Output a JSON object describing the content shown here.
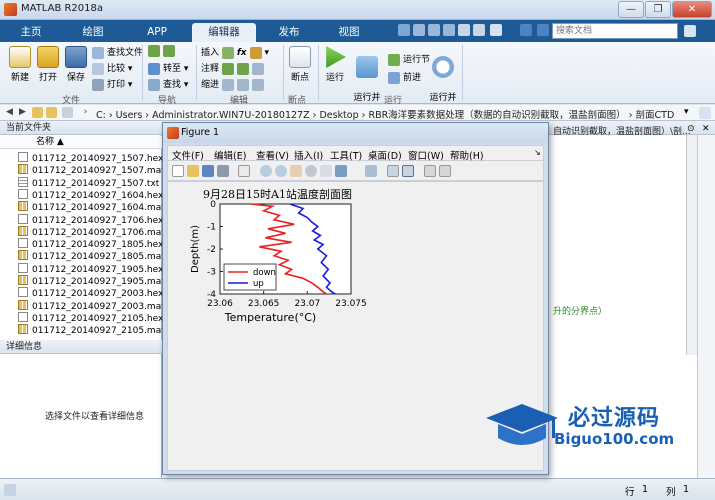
{
  "app": {
    "title": "MATLAB R2018a",
    "window_controls": [
      "—",
      "❐",
      "✕"
    ]
  },
  "ribbon_tabs": [
    {
      "label": "主页",
      "active": false
    },
    {
      "label": "绘图",
      "active": false
    },
    {
      "label": "APP",
      "active": false
    },
    {
      "label": "编辑器",
      "active": true
    },
    {
      "label": "发布",
      "active": false
    },
    {
      "label": "视图",
      "active": false
    }
  ],
  "search": {
    "placeholder": "搜索文档"
  },
  "ribbon": {
    "file": {
      "group": "文件",
      "new": "新建",
      "open": "打开",
      "save": "保存",
      "find_files": "查找文件",
      "compare": "比较",
      "print": "打印"
    },
    "nav": {
      "group": "导航",
      "goto": "转至",
      "find": "查找"
    },
    "edit": {
      "group": "编辑",
      "insert": "插入",
      "comment": "注释",
      "indent": "缩进"
    },
    "breakpoints": {
      "group": "断点",
      "label": "断点"
    },
    "run": {
      "group": "运行",
      "run": "运行",
      "run_advance": "运行并\n前进",
      "run_section": "运行节",
      "advance": "前进",
      "run_time": "运行并\n计时"
    }
  },
  "address": {
    "path": "C: › Users › Administrator.WIN7U-20180127Z › Desktop › RBR海洋要素数据处理（数据的自动识别截取，温盐剖面图） › 剖面CTD"
  },
  "current_folder": {
    "title": "当前文件夹",
    "column": "名称 ▲",
    "files": [
      {
        "name": "011712_20140927_1507.hex",
        "type": "hex"
      },
      {
        "name": "011712_20140927_1507.mat",
        "type": "mat"
      },
      {
        "name": "011712_20140927_1507.txt",
        "type": "txt"
      },
      {
        "name": "011712_20140927_1604.hex",
        "type": "hex"
      },
      {
        "name": "011712_20140927_1604.mat",
        "type": "mat"
      },
      {
        "name": "011712_20140927_1706.hex",
        "type": "hex"
      },
      {
        "name": "011712_20140927_1706.mat",
        "type": "mat"
      },
      {
        "name": "011712_20140927_1805.hex",
        "type": "hex"
      },
      {
        "name": "011712_20140927_1805.mat",
        "type": "mat"
      },
      {
        "name": "011712_20140927_1905.hex",
        "type": "hex"
      },
      {
        "name": "011712_20140927_1905.mat",
        "type": "mat"
      },
      {
        "name": "011712_20140927_2003.hex",
        "type": "hex"
      },
      {
        "name": "011712_20140927_2003.mat",
        "type": "mat"
      },
      {
        "name": "011712_20140927_2105.hex",
        "type": "hex"
      },
      {
        "name": "011712_20140927_2105.mat",
        "type": "mat"
      }
    ]
  },
  "details": {
    "title": "详细信息",
    "message": "选择文件以查看详细信息"
  },
  "command_window": {
    "path_fragment": "自动识别截取，温盐剖面图）\\剖...",
    "green_comment": "升的分界点）"
  },
  "status": {
    "row_label": "行",
    "row": "1",
    "col_label": "列",
    "col": "1"
  },
  "figure": {
    "title": "Figure 1",
    "menu": [
      "文件(F)",
      "编辑(E)",
      "查看(V)",
      "插入(I)",
      "工具(T)",
      "桌面(D)",
      "窗口(W)",
      "帮助(H)"
    ]
  },
  "chart_data": {
    "type": "line",
    "title": "9月28日15时A1站温度剖面图",
    "xlabel": "Temperature(°C)",
    "ylabel": "Depth(m)",
    "xlim": [
      23.06,
      23.075
    ],
    "ylim": [
      -4,
      0
    ],
    "xticks": [
      "23.06",
      "23.065",
      "23.07",
      "23.075"
    ],
    "yticks": [
      "0",
      "-1",
      "-2",
      "-3",
      "-4"
    ],
    "legend": "bottom-left",
    "series": [
      {
        "name": "down",
        "color": "#e8231f",
        "x": [
          23.0635,
          23.066,
          23.065,
          23.0668,
          23.0662,
          23.0685,
          23.0655,
          23.0675,
          23.0652,
          23.0682,
          23.0645,
          23.067,
          23.0662,
          23.0678,
          23.0668,
          23.0682,
          23.0675,
          23.0695,
          23.0705,
          23.0712,
          23.0718,
          23.0722
        ],
        "y": [
          0,
          -0.1,
          -0.3,
          -0.5,
          -0.7,
          -0.9,
          -1.1,
          -1.3,
          -1.5,
          -1.7,
          -1.9,
          -2.1,
          -2.3,
          -2.5,
          -2.7,
          -2.9,
          -3.1,
          -3.3,
          -3.5,
          -3.7,
          -3.9,
          -4.0
        ]
      },
      {
        "name": "up",
        "color": "#1a1ae6",
        "x": [
          23.068,
          23.0695,
          23.069,
          23.07,
          23.0705,
          23.0712,
          23.0706,
          23.0715,
          23.0708,
          23.0718,
          23.0712,
          23.0722,
          23.0716,
          23.0724,
          23.0718,
          23.0726,
          23.0722,
          23.0728,
          23.0732
        ],
        "y": [
          0,
          -0.2,
          -0.4,
          -0.6,
          -0.8,
          -1.0,
          -1.2,
          -1.4,
          -1.6,
          -1.8,
          -2.0,
          -2.3,
          -2.6,
          -2.9,
          -3.2,
          -3.5,
          -3.7,
          -3.9,
          -4.0
        ]
      }
    ]
  },
  "watermark": {
    "title": "必过源码",
    "subtitle": "Biguo100.com"
  },
  "colors": {
    "ribbon_tab_bar": "#1d5a96",
    "accent": "#1a5fb4"
  }
}
